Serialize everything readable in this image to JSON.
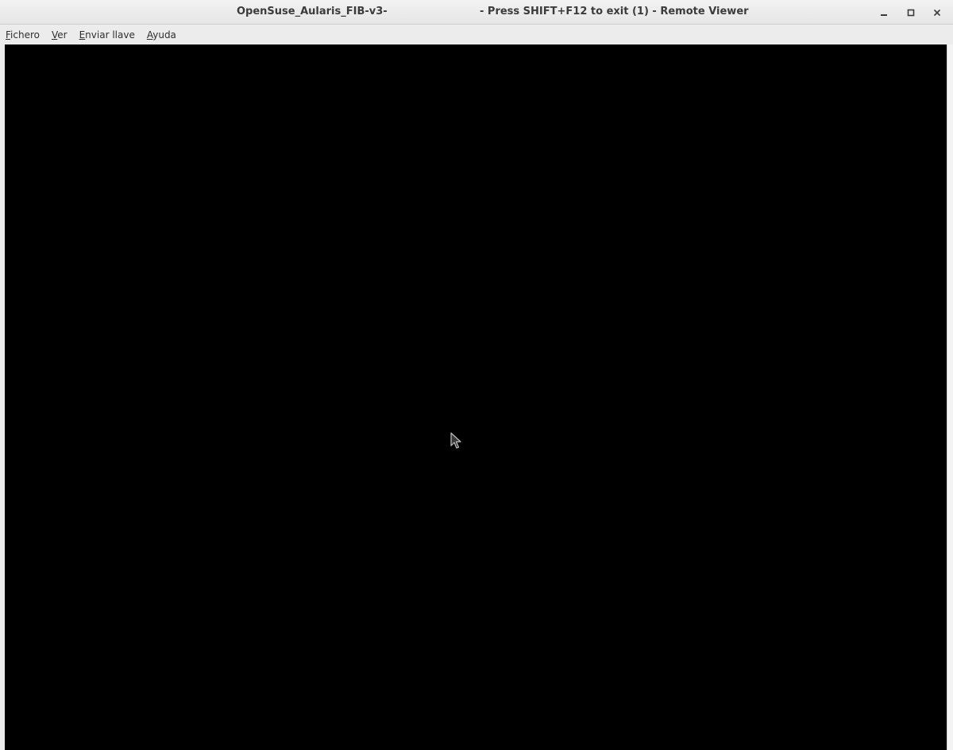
{
  "window": {
    "title_left": "OpenSuse_Aularis_FIB-v3-",
    "title_right": "- Press SHIFT+F12 to exit (1) - Remote Viewer",
    "controls": {
      "minimize_icon": "minimize-icon",
      "maximize_icon": "maximize-icon",
      "close_icon": "close-icon"
    }
  },
  "menubar": {
    "items": [
      {
        "mnemonic": "F",
        "rest": "ichero"
      },
      {
        "mnemonic": "V",
        "rest": "er"
      },
      {
        "mnemonic": "E",
        "rest": "nviar llave"
      },
      {
        "mnemonic": "A",
        "rest": "yuda"
      }
    ]
  },
  "viewport": {
    "background": "#000000",
    "cursor_icon": "mouse-pointer-icon"
  }
}
